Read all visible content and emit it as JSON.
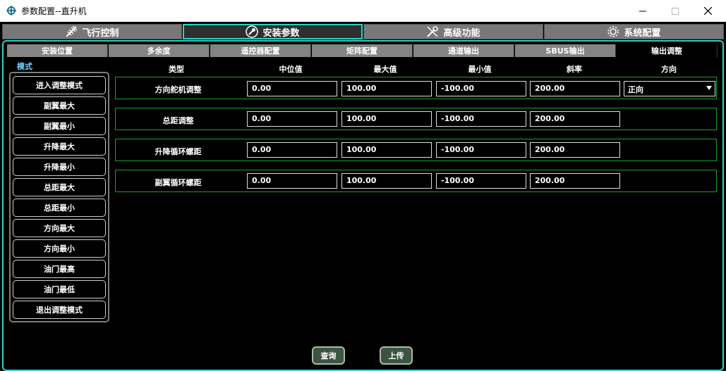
{
  "window": {
    "title": "参数配置--直升机"
  },
  "main_tabs": [
    {
      "label": "飞行控制",
      "icon": "plane-icon",
      "active": false
    },
    {
      "label": "安装参数",
      "icon": "wrench-icon",
      "active": true
    },
    {
      "label": "高级功能",
      "icon": "tools-icon",
      "active": false
    },
    {
      "label": "系统配置",
      "icon": "gear-icon",
      "active": false
    }
  ],
  "sub_tabs": [
    {
      "label": "安装位置",
      "active": false
    },
    {
      "label": "多余度",
      "active": false
    },
    {
      "label": "遥控器配置",
      "active": false
    },
    {
      "label": "矩阵配置",
      "active": false
    },
    {
      "label": "通道输出",
      "active": false
    },
    {
      "label": "SBUS输出",
      "active": false
    },
    {
      "label": "输出调整",
      "active": true
    }
  ],
  "mode": {
    "label": "模式",
    "buttons": [
      "进入调整模式",
      "副翼最大",
      "副翼最小",
      "升降最大",
      "升降最小",
      "总距最大",
      "总距最小",
      "方向最大",
      "方向最小",
      "油门最高",
      "油门最低",
      "退出调整模式"
    ]
  },
  "columns": {
    "type": "类型",
    "mid": "中位值",
    "max": "最大值",
    "min": "最小值",
    "slope": "斜率",
    "direction": "方向"
  },
  "rows": [
    {
      "label": "方向舵机调整",
      "mid": "0.00",
      "max": "100.00",
      "min": "-100.00",
      "slope": "200.00",
      "direction": "正向"
    },
    {
      "label": "总距调整",
      "mid": "0.00",
      "max": "100.00",
      "min": "-100.00",
      "slope": "200.00"
    },
    {
      "label": "升降循环螺距",
      "mid": "0.00",
      "max": "100.00",
      "min": "-100.00",
      "slope": "200.00"
    },
    {
      "label": "副翼循环螺距",
      "mid": "0.00",
      "max": "100.00",
      "min": "-100.00",
      "slope": "200.00"
    }
  ],
  "actions": {
    "query": "查询",
    "upload": "上传"
  },
  "colors": {
    "accent": "#2ad4c4",
    "row_border": "#1f9e27",
    "mode_label": "#6fd0ff",
    "button_fill": "#3d5440"
  }
}
